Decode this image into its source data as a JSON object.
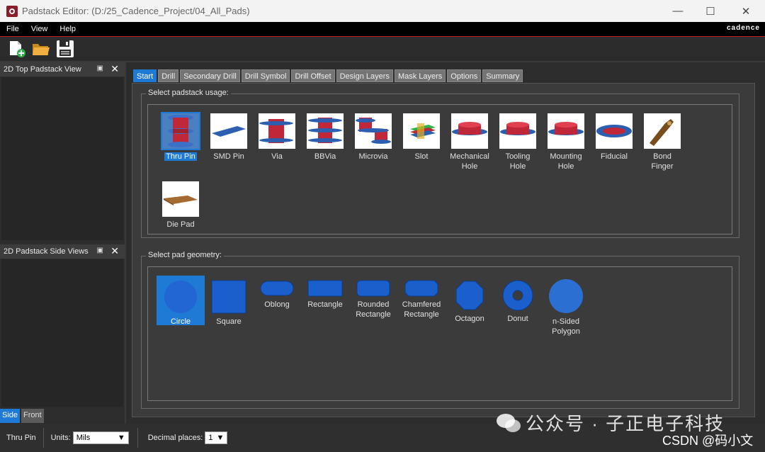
{
  "window": {
    "title": "Padstack Editor:   (D:/25_Cadence_Project/04_All_Pads)"
  },
  "menu": {
    "file": "File",
    "view": "View",
    "help": "Help",
    "brand": "cadence"
  },
  "panels": {
    "top_view": {
      "title": "2D Top Padstack View"
    },
    "side_views": {
      "title": "2D Padstack Side Views"
    },
    "bottom_tabs": {
      "side": "Side",
      "front": "Front"
    }
  },
  "tabs": [
    "Start",
    "Drill",
    "Secondary Drill",
    "Drill Symbol",
    "Drill Offset",
    "Design Layers",
    "Mask Layers",
    "Options",
    "Summary"
  ],
  "usage": {
    "label": "Select padstack usage:",
    "items": [
      {
        "name": "Thru Pin",
        "line2": ""
      },
      {
        "name": "SMD Pin",
        "line2": ""
      },
      {
        "name": "Via",
        "line2": ""
      },
      {
        "name": "BBVia",
        "line2": ""
      },
      {
        "name": "Microvia",
        "line2": ""
      },
      {
        "name": "Slot",
        "line2": ""
      },
      {
        "name": "Mechanical",
        "line2": "Hole"
      },
      {
        "name": "Tooling",
        "line2": "Hole"
      },
      {
        "name": "Mounting",
        "line2": "Hole"
      },
      {
        "name": "Fiducial",
        "line2": ""
      },
      {
        "name": "Bond",
        "line2": "Finger"
      },
      {
        "name": "Die Pad",
        "line2": ""
      }
    ]
  },
  "geometry": {
    "label": "Select pad geometry:",
    "items": [
      {
        "name": "Circle",
        "line2": ""
      },
      {
        "name": "Square",
        "line2": ""
      },
      {
        "name": "Oblong",
        "line2": ""
      },
      {
        "name": "Rectangle",
        "line2": ""
      },
      {
        "name": "Rounded",
        "line2": "Rectangle"
      },
      {
        "name": "Chamfered",
        "line2": "Rectangle"
      },
      {
        "name": "Octagon",
        "line2": ""
      },
      {
        "name": "Donut",
        "line2": ""
      },
      {
        "name": "n-Sided",
        "line2": "Polygon"
      }
    ]
  },
  "status": {
    "usage": "Thru Pin",
    "units_label": "Units:",
    "units_value": "Mils",
    "decimal_label": "Decimal places:",
    "decimal_value": "1"
  },
  "watermark": {
    "text": "公众号 · 子正电子科技",
    "csdn": "CSDN @码小文"
  }
}
